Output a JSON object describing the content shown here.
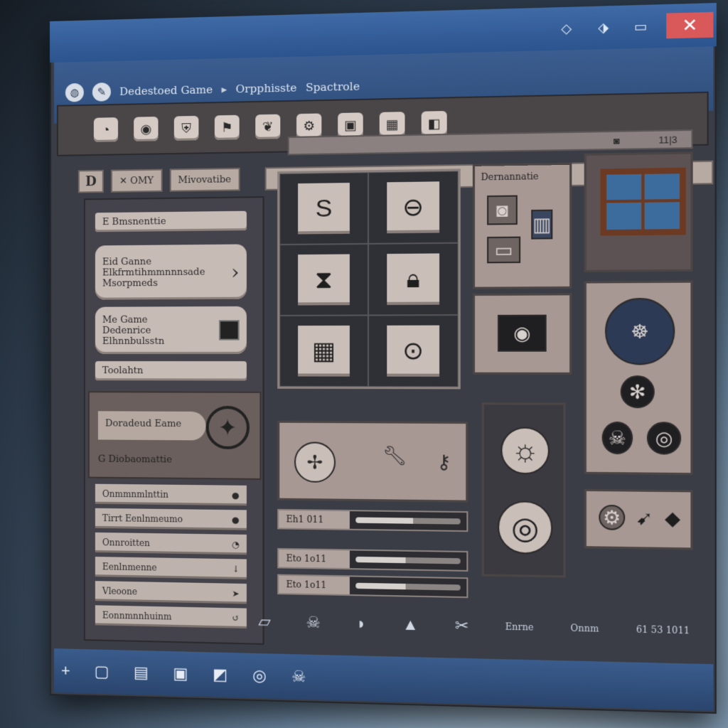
{
  "window": {
    "close_label": "✕"
  },
  "appbar": {
    "crumbs": [
      "Dedestoed Game",
      "Orpphisste",
      "Spactrole"
    ],
    "separator": "▸"
  },
  "addressbar": {
    "right_text": "11|3"
  },
  "tabs": [
    {
      "label": "D"
    },
    {
      "label": "✕ OMY"
    },
    {
      "label": "Mivovatibe"
    }
  ],
  "sidebar": {
    "top_item": "E Bmsnenttie",
    "cards": [
      {
        "title": "Eid Ganne",
        "lines": [
          "Elkfrmtihmmnnnsade",
          "Msorpmeds"
        ]
      },
      {
        "title": "Me Game",
        "lines": [
          "Dedenrice",
          "Elhnnbulsstn"
        ]
      }
    ],
    "toolbar_item": "Toolahtn",
    "game_box": {
      "label": "Doradeud Eame",
      "sub": "G Diobaomattie"
    },
    "list": [
      {
        "label": "Onmmnmlnttin",
        "icon": "●"
      },
      {
        "label": "Tirrt Eenlnmeumo",
        "icon": "●"
      },
      {
        "label": "Onnroitten",
        "icon": "◔"
      },
      {
        "label": "Eenlnmenne",
        "icon": "↓"
      },
      {
        "label": "Vleoone",
        "icon": "➤"
      },
      {
        "label": "Eonnmnnhuinm",
        "icon": "↺"
      }
    ]
  },
  "right_panel": {
    "title": "Dernannatie"
  },
  "sliders": [
    {
      "label": "Eh1 011",
      "value": 0.55
    },
    {
      "label": "Eto 1o11",
      "value": 0.48
    },
    {
      "label": "Eto 1o11",
      "value": 0.48
    }
  ],
  "statusbar": {
    "left": "Enrne",
    "mid": "Onnm",
    "right": "61 53 1011"
  }
}
